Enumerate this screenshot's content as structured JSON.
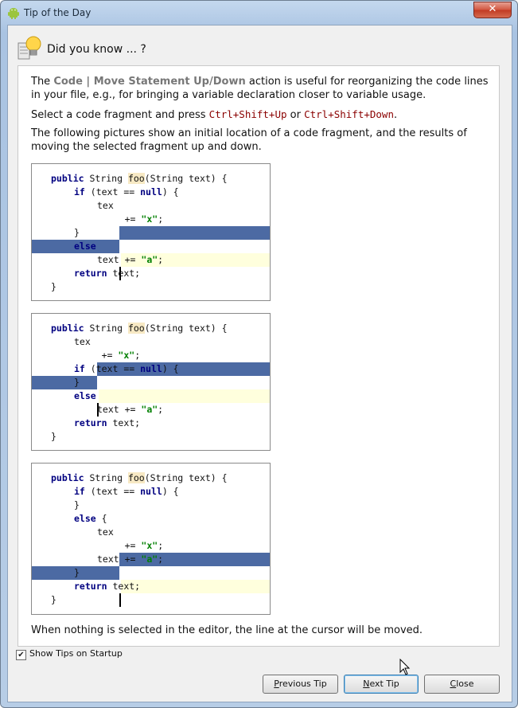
{
  "window": {
    "title": "Tip of the Day",
    "close_glyph": "✕"
  },
  "header": {
    "title": "Did you know ... ?"
  },
  "tip": {
    "p1_pre": "The ",
    "p1_action": "Code | Move Statement Up/Down",
    "p1_post": " action is useful for reorganizing the code lines in your file, e.g., for bringing a variable declaration closer to variable usage.",
    "p2_pre": "Select a code fragment and press ",
    "p2_key1": "Ctrl+Shift+Up",
    "p2_mid": " or ",
    "p2_key2": "Ctrl+Shift+Down",
    "p2_post": ".",
    "p3": "The following pictures show an initial location of a code fragment, and the results of moving the selected fragment up and down.",
    "p4": "When nothing is selected in the editor, the line at the cursor will be moved."
  },
  "code": {
    "kw_public": "public",
    "type_string": " String ",
    "fn_foo": "foo",
    "sig_tail": "(String text) {",
    "kw_if": "if",
    "if_mid": " (text == ",
    "kw_null": "null",
    "if_tail": ") {",
    "close_brace": "}",
    "kw_else": "else",
    "else_brace": " {",
    "text_word": "text",
    "txt_a": "tex",
    "txt_b": "t",
    "assign_empty": " = \"\";",
    "plus_eq": " += ",
    "str_x": "\"x\"",
    "str_a": "\"a\"",
    "semi": ";",
    "else_text": "text += ",
    "kw_return": "return",
    "return_tail": " text;"
  },
  "footer": {
    "checkbox_glyph": "✔",
    "show_tips_label": "Show Tips on Startup",
    "prev_label_u": "P",
    "prev_label_rest": "revious Tip",
    "next_label_u": "N",
    "next_label_rest": "ext Tip",
    "close_label_u": "C",
    "close_label_rest": "lose"
  }
}
